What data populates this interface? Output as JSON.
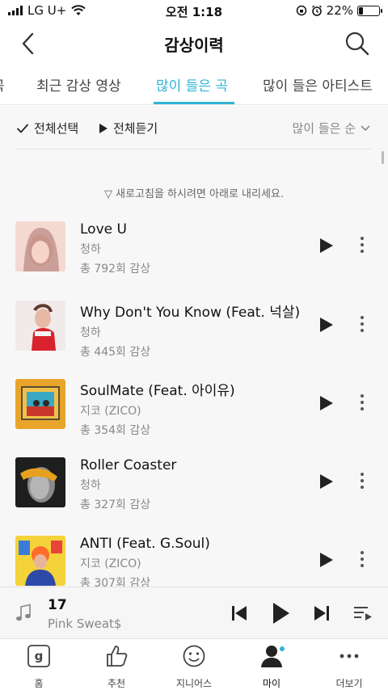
{
  "status_bar": {
    "carrier": "LG U+",
    "time": "오전 1:18",
    "battery": "22%",
    "battery_level": 0.22
  },
  "header": {
    "title": "감상이력",
    "back_icon": "chevron-left-icon",
    "search_icon": "search-icon"
  },
  "tabs": [
    {
      "label": "곡",
      "active": false
    },
    {
      "label": "최근 감상 영상",
      "active": false
    },
    {
      "label": "많이 들은 곡",
      "active": true
    },
    {
      "label": "많이 들은 아티스트",
      "active": false
    }
  ],
  "toolbar": {
    "select_all": "전체선택",
    "play_all": "전체듣기",
    "sort": "많이 들은 순"
  },
  "refresh_hint": "▽ 새로고침을 하시려면 아래로 내리세요.",
  "songs": [
    {
      "title": "Love U",
      "artist": "청하",
      "count": "총 792회 감상"
    },
    {
      "title": "Why Don't You Know (Feat. 넉살)",
      "artist": "청하",
      "count": "총 445회 감상"
    },
    {
      "title": "SoulMate (Feat. 아이유)",
      "artist": "지코 (ZICO)",
      "count": "총 354회 감상"
    },
    {
      "title": "Roller Coaster",
      "artist": "청하",
      "count": "총 327회 감상"
    },
    {
      "title": "ANTI (Feat. G.Soul)",
      "artist": "지코 (ZICO)",
      "count": "총 307회 감상"
    }
  ],
  "player": {
    "title": "17",
    "artist": "Pink Sweat$"
  },
  "bottom_nav": [
    {
      "label": "홈",
      "icon": "home-g-icon"
    },
    {
      "label": "추천",
      "icon": "thumbs-up-icon"
    },
    {
      "label": "지니어스",
      "icon": "smiley-icon"
    },
    {
      "label": "마이",
      "icon": "person-icon",
      "active": true
    },
    {
      "label": "더보기",
      "icon": "more-dots-icon"
    }
  ],
  "colors": {
    "accent": "#2fb3d6",
    "text": "#111111",
    "muted": "#888888"
  }
}
